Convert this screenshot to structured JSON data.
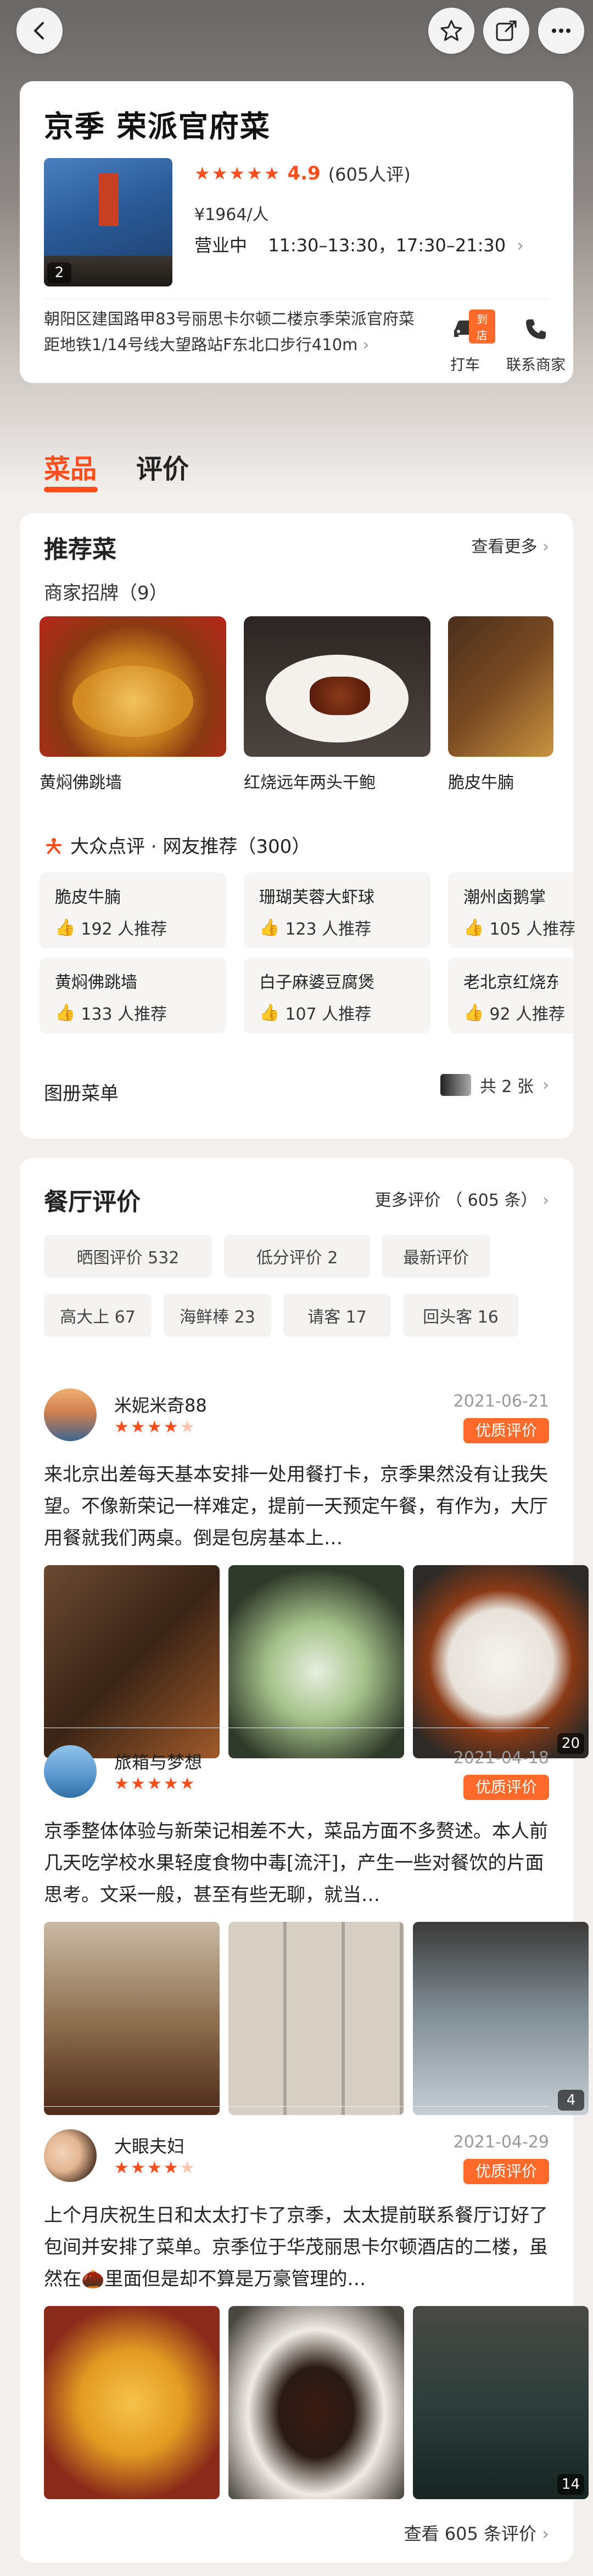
{
  "shop": {
    "name": "京季 荣派官府菜",
    "cover_count": "2",
    "rating": "4.9",
    "rating_count": "(605人评)",
    "price": "¥1964/人",
    "status": "营业中",
    "hours": "11:30–13:30，17:30–21:30",
    "address": "朝阳区建国路甲83号丽思卡尔顿二楼京季荣派官府菜 距地铁1/14号线大望路站F东北口步行410m",
    "taxi_label": "打车",
    "taxi_badge": "到店",
    "contact_label": "联系商家"
  },
  "tabs": [
    {
      "label": "菜品"
    },
    {
      "label": "评价"
    }
  ],
  "recommended": {
    "title": "推荐菜",
    "more": "查看更多",
    "signature_title": "商家招牌（9）",
    "dishes": [
      {
        "name": "黄焖佛跳墙"
      },
      {
        "name": "红烧远年两头干鲍"
      },
      {
        "name": "脆皮牛腩"
      }
    ],
    "netizen_title": "大众点评 · 网友推荐（300）",
    "netizen_items": [
      {
        "name": "脆皮牛腩",
        "count": "192 人推荐"
      },
      {
        "name": "珊瑚芙蓉大虾球",
        "count": "123 人推荐"
      },
      {
        "name": "潮州卤鹅掌",
        "count": "105 人推荐"
      },
      {
        "name": "黄焖佛跳墙",
        "count": "133 人推荐"
      },
      {
        "name": "白子麻婆豆腐煲",
        "count": "107 人推荐"
      },
      {
        "name": "老北京红烧东海",
        "count": "92 人推荐"
      }
    ],
    "menu_album_label": "图册菜单",
    "menu_album_count": "共 2 张"
  },
  "reviews": {
    "title": "餐厅评价",
    "more": "更多评价 （ 605 条）",
    "filters": [
      {
        "label": "晒图评价 532"
      },
      {
        "label": "低分评价 2"
      },
      {
        "label": "最新评价"
      },
      {
        "label": "高大上 67"
      },
      {
        "label": "海鲜棒 23"
      },
      {
        "label": "请客 17"
      },
      {
        "label": "回头客 16"
      }
    ],
    "items": [
      {
        "user": "米妮米奇88",
        "date": "2021-06-21",
        "badge": "优质评价",
        "text": "来北京出差每天基本安排一处用餐打卡，京季果然没有让我失望。不像新荣记一样难定，提前一天预定午餐，有作为，大厅用餐就我们两桌。倒是包房基本上…",
        "photo_count": "20"
      },
      {
        "user": "旅箱与梦想",
        "date": "2021-04-18",
        "badge": "优质评价",
        "text": "京季整体体验与新荣记相差不大，菜品方面不多赘述。本人前几天吃学校水果轻度食物中毒[流汗]，产生一些对餐饮的片面思考。文采一般，甚至有些无聊，就当…",
        "photo_count": "4"
      },
      {
        "user": "大眼夫妇",
        "date": "2021-04-29",
        "badge": "优质评价",
        "text": "上个月庆祝生日和太太打卡了京季，太太提前联系餐厅订好了包间并安排了菜单。京季位于华茂丽思卡尔顿酒店的二楼，虽然在🌰里面但是却不算是万豪管理的…",
        "photo_count": "14"
      }
    ],
    "view_all": "查看 605 条评价"
  },
  "colors": {
    "accent": "#ff4e1d",
    "badge": "#ff6a2a",
    "background": "#f2efed"
  }
}
